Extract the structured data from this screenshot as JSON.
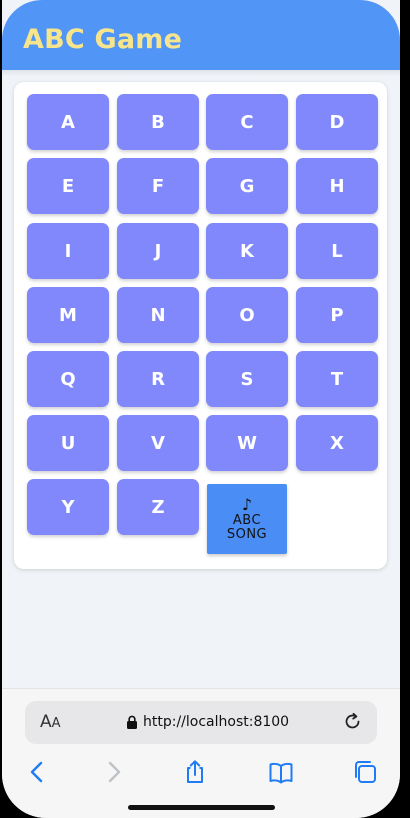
{
  "app": {
    "title": "ABC Game"
  },
  "letters": [
    "A",
    "B",
    "C",
    "D",
    "E",
    "F",
    "G",
    "H",
    "I",
    "J",
    "K",
    "L",
    "M",
    "N",
    "O",
    "P",
    "Q",
    "R",
    "S",
    "T",
    "U",
    "V",
    "W",
    "X",
    "Y",
    "Z"
  ],
  "song_button": {
    "icon": "music-note-icon",
    "glyph": "♪",
    "line1": "ABC",
    "line2": "SONG"
  },
  "browser": {
    "text_size_label_big": "A",
    "text_size_label_small": "A",
    "url": "http://localhost:8100",
    "icons": {
      "lock": "lock-icon",
      "reload": "reload-icon",
      "back": "back-chevron-icon",
      "forward": "forward-chevron-icon",
      "share": "share-icon",
      "bookmarks": "bookmarks-icon",
      "tabs": "tabs-icon"
    }
  },
  "colors": {
    "header": "#5195f7",
    "title": "#f6e58d",
    "letter_button": "#8088fb",
    "song_button": "#4a8ef5",
    "ios_blue": "#1f7cf5",
    "disabled": "#bfc2c8"
  }
}
